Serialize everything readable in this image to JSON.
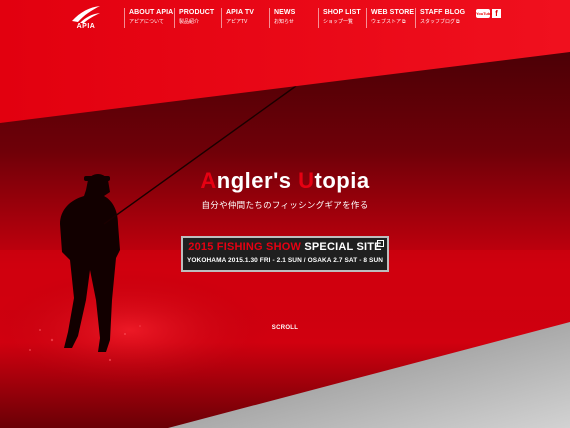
{
  "brand": {
    "logo_text": "APIA"
  },
  "nav": {
    "items": [
      {
        "en": "ABOUT APIA",
        "ja": "アピアについて",
        "external": ""
      },
      {
        "en": "PRODUCT",
        "ja": "製品紹介",
        "external": ""
      },
      {
        "en": "APIA TV",
        "ja": "アピアTV",
        "external": ""
      },
      {
        "en": "NEWS",
        "ja": "お知らせ",
        "external": ""
      },
      {
        "en": "SHOP LIST",
        "ja": "ショップ一覧",
        "external": ""
      },
      {
        "en": "WEB STORE",
        "ja": "ウェブストア",
        "external": "⧉"
      },
      {
        "en": "STAFF BLOG",
        "ja": "スタッフブログ",
        "external": "⧉"
      }
    ],
    "social": {
      "youtube_label": "YouTube",
      "facebook_label": "f"
    }
  },
  "hero": {
    "title": "Angler's Utopia",
    "subtitle": "自分や仲間たちのフィッシングギアを作る",
    "banner": {
      "headline_red": "2015 FISHING SHOW",
      "headline_white": "SPECIAL SITE",
      "details": "YOKOHAMA 2015.1.30 FRI - 2.1 SUN / OSAKA 2.7 SAT - 8 SUN",
      "icon": "external-link-icon"
    },
    "scroll_label": "SCROLL"
  },
  "colors": {
    "accent": "#e60012",
    "banner_bg": "#1f1f1f"
  }
}
